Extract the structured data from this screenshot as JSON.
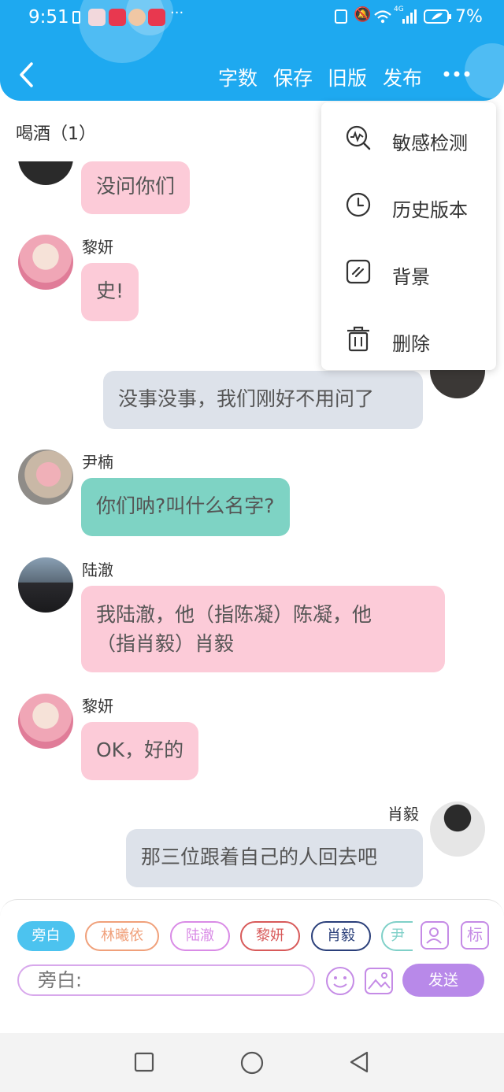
{
  "status_bar": {
    "time": "9:51",
    "battery": "7%",
    "signal": "4G",
    "more": "···"
  },
  "toolbar": {
    "word_count": "字数",
    "save": "保存",
    "old_version": "旧版",
    "publish": "发布"
  },
  "chat": {
    "title": "喝酒（1）",
    "messages": [
      {
        "sender": "",
        "text": "没问你们",
        "style": "pink"
      },
      {
        "sender": "黎妍",
        "text": "史!",
        "style": "pink"
      },
      {
        "sender": "",
        "text": "没事没事，我们刚好不用问了",
        "style": "gray"
      },
      {
        "sender": "尹楠",
        "text": "你们呐?叫什么名字?",
        "style": "teal"
      },
      {
        "sender": "陆澈",
        "text_line1": "我陆澈，他（指陈凝）陈凝，他",
        "text_line2": "（指肖毅）肖毅",
        "style": "pink"
      },
      {
        "sender": "黎妍",
        "text": "OK，好的",
        "style": "pink"
      },
      {
        "sender": "肖毅",
        "text": "那三位跟着自己的人回去吧",
        "style": "gray"
      }
    ]
  },
  "menu": {
    "items": [
      {
        "label": "敏感检测",
        "icon": "sensitive-check-icon"
      },
      {
        "label": "历史版本",
        "icon": "clock-icon"
      },
      {
        "label": "背景",
        "icon": "background-icon"
      },
      {
        "label": "删除",
        "icon": "trash-icon"
      }
    ]
  },
  "composer": {
    "characters": [
      {
        "label": "旁白",
        "color": "#4cc3ef",
        "selected": true
      },
      {
        "label": "林曦依",
        "color": "#f0a07a"
      },
      {
        "label": "陆澈",
        "color": "#d98be6"
      },
      {
        "label": "黎妍",
        "color": "#d85a5a"
      },
      {
        "label": "肖毅",
        "color": "#2a3f7a"
      },
      {
        "label": "尹",
        "color": "#7fd0c8"
      }
    ],
    "mark_label": "标",
    "input_placeholder": "旁白:",
    "send_label": "发送"
  },
  "colors": {
    "header": "#1ea9f0",
    "pink_bubble": "#fccbd8",
    "gray_bubble": "#dde2ea",
    "teal_bubble": "#7ed3c4",
    "send": "#b889e9"
  }
}
